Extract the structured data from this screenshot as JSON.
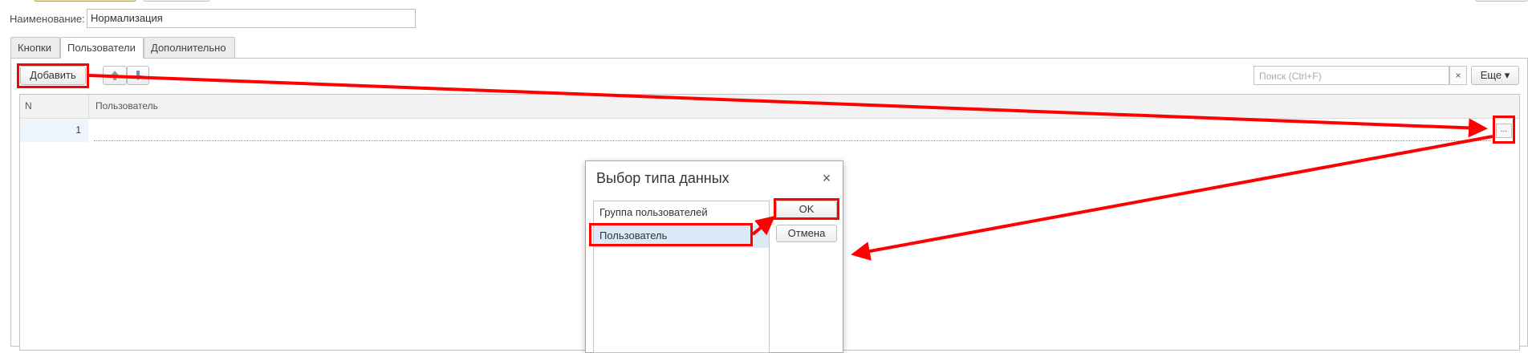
{
  "form": {
    "name_label": "Наименование:",
    "name_value": "Нормализация"
  },
  "tabs": [
    {
      "label": "Кнопки",
      "active": false
    },
    {
      "label": "Пользователи",
      "active": true
    },
    {
      "label": "Дополнительно",
      "active": false
    }
  ],
  "toolbar": {
    "add_label": "Добавить",
    "up_icon": "arrow-up-icon",
    "down_icon": "arrow-down-icon",
    "search_placeholder": "Поиск (Ctrl+F)",
    "clear_label": "×",
    "more_label": "Еще ▾"
  },
  "table": {
    "columns": [
      "N",
      "Пользователь"
    ],
    "rows": [
      {
        "n": "1",
        "user": ""
      }
    ],
    "ellipsis_label": "..."
  },
  "dialog": {
    "title": "Выбор типа данных",
    "close_label": "×",
    "items": [
      "Группа пользователей",
      "Пользователь"
    ],
    "selected_index": 1,
    "ok_label": "OK",
    "cancel_label": "Отмена"
  },
  "colors": {
    "annotation": "#ff0000",
    "selection": "#dbe9f9",
    "row_number_bg": "#eef4fb"
  }
}
